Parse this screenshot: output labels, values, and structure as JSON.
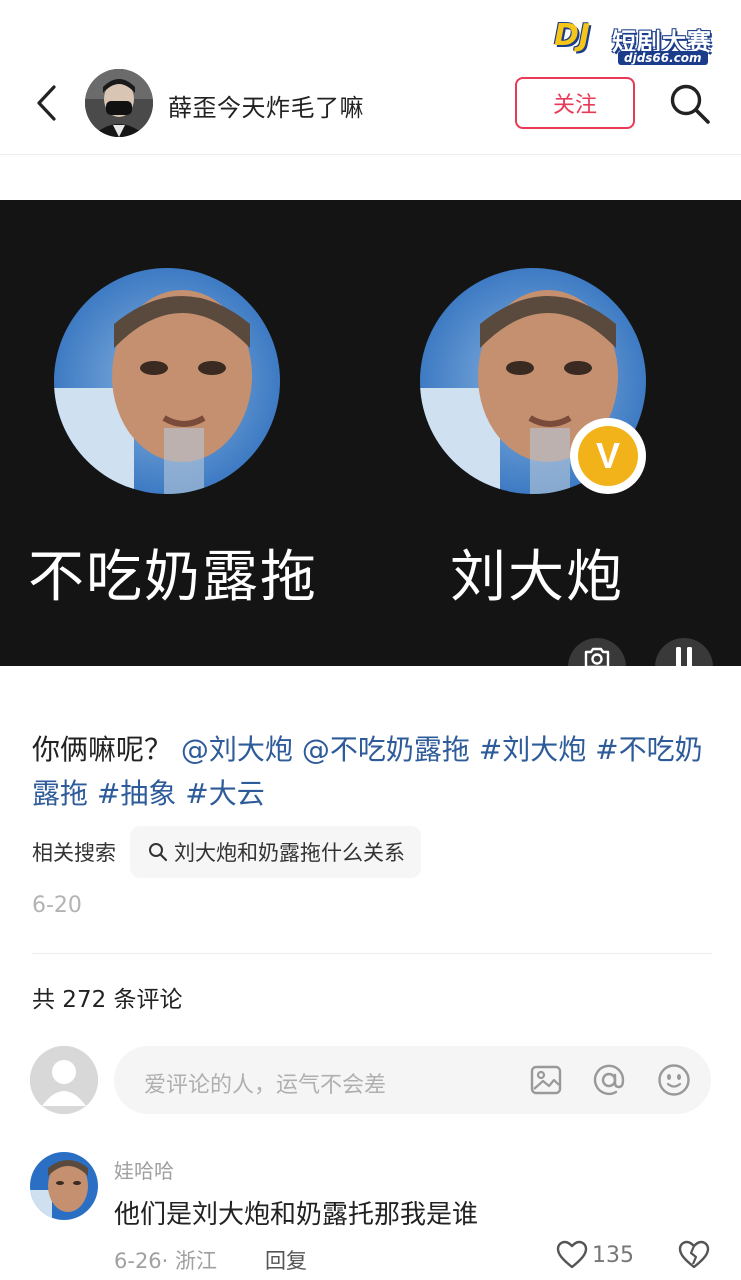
{
  "header": {
    "author_name": "薛歪今天炸毛了嘛",
    "follow_label": "关注"
  },
  "watermark": {
    "logo": "DJ",
    "title": "短剧大赛",
    "url": "djds66.com"
  },
  "media": {
    "left_name": "不吃奶露拖",
    "right_name": "刘大炮",
    "badge_letter": "V"
  },
  "post": {
    "caption_text": "你俩嘛呢？",
    "mentions": [
      "@刘大炮",
      "@不吃奶露拖"
    ],
    "hashtags": [
      "#刘大炮",
      "#不吃奶露拖",
      "#抽象",
      "#大云"
    ],
    "related_label": "相关搜索",
    "related_query": "刘大炮和奶露拖什么关系",
    "date": "6-20"
  },
  "comments": {
    "count_text": "共 272 条评论",
    "input_placeholder": "爱评论的人，运气不会差",
    "items": [
      {
        "user": "娃哈哈",
        "text": "他们是刘大炮和奶露托那我是谁",
        "meta": "6-26· 浙江",
        "reply_label": "回复",
        "likes": "135"
      }
    ]
  },
  "icons": {
    "back": "chevron-left-icon",
    "search": "search-icon",
    "camera": "camera-icon",
    "pause": "pause-icon",
    "image": "image-icon",
    "mention": "at-icon",
    "emoji": "emoji-icon",
    "like": "heart-icon",
    "dislike": "broken-heart-icon"
  },
  "colors": {
    "accent": "#e83a57",
    "link": "#2e5b9a",
    "media_bg": "#141414",
    "badge": "#f1b21a"
  }
}
